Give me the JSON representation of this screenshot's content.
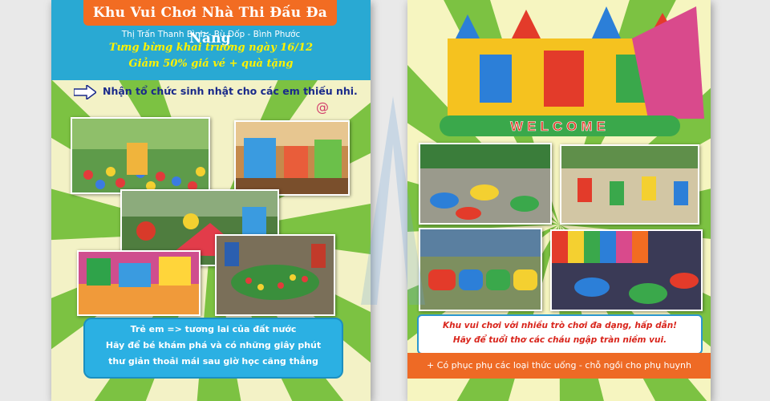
{
  "flyer_left": {
    "title": "Khu Vui Chơi Nhà Thi Đấu Đa Năng",
    "location": "Thị Trấn Thanh Bình - Bù Đốp - Bình Phước",
    "slogan_line1": "Tưng bừng khai trương ngày 16/12",
    "slogan_line2": "Giảm 50% giá vé + quà tặng",
    "party_text": "Nhận tổ chức sinh nhật cho các em thiếu nhi.",
    "bottom_lines": [
      "Trẻ em => tương lai của đất nước",
      "Hãy để bé khám phá và có những giây phút",
      "thư giản thoải mái sau giờ học căng thẳng"
    ]
  },
  "flyer_right": {
    "welcome_sign": "WELCOME",
    "info_line1": "Khu vui chơi với nhiều trò chơi đa dạng, hấp dẫn!",
    "info_line2": "Hãy để tuổi thơ các cháu ngập tràn niềm vui.",
    "footer": "+ Có phục phụ các loại thức uống - chỗ ngồi cho phụ huynh"
  },
  "colors": {
    "sky_blue": "#29a9d3",
    "orange": "#f26c22",
    "yellow_text": "#fff200",
    "ray_green": "#7cc242",
    "ray_cream": "#f3f2c6",
    "red_text": "#d9251c"
  },
  "icons": [
    "right-arrow-icon",
    "swirl-lollipop-icon"
  ]
}
